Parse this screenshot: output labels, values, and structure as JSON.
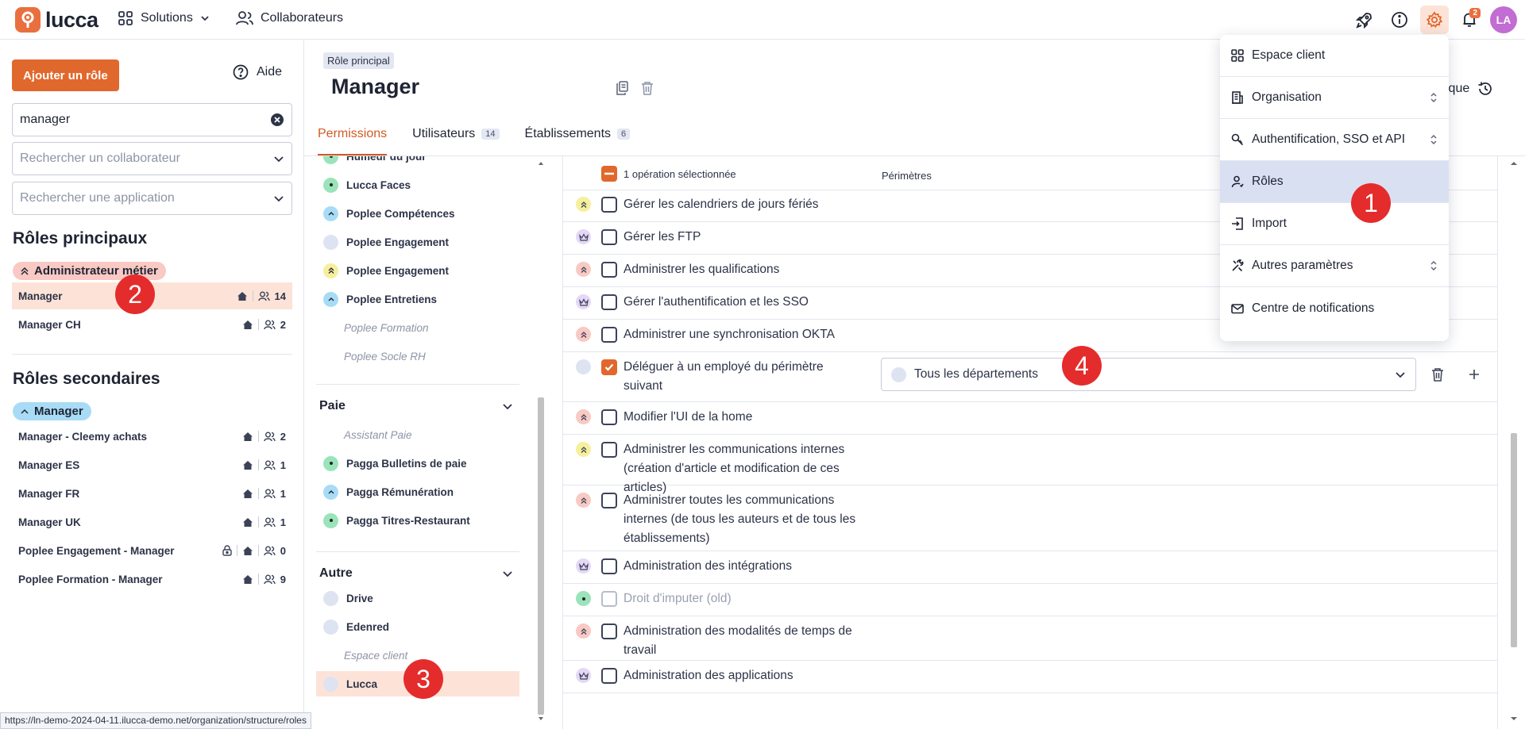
{
  "topbar": {
    "logo": "lucca",
    "nav": [
      {
        "label": "Solutions",
        "icon": "grid-icon"
      },
      {
        "label": "Collaborateurs",
        "icon": "users-icon"
      }
    ],
    "notification_count": "2",
    "avatar_initials": "LA"
  },
  "left": {
    "add_button": "Ajouter un rôle",
    "help": "Aide",
    "search_value": "manager",
    "collab_placeholder": "Rechercher un collaborateur",
    "app_placeholder": "Rechercher une application",
    "primary_title": "Rôles principaux",
    "primary_tag": "Administrateur métier",
    "primary_roles": [
      {
        "name": "Manager",
        "count": "14"
      },
      {
        "name": "Manager CH",
        "count": "2"
      }
    ],
    "secondary_title": "Rôles secondaires",
    "secondary_tag": "Manager",
    "secondary_roles": [
      {
        "name": "Manager - Cleemy achats",
        "count": "2"
      },
      {
        "name": "Manager ES",
        "count": "1"
      },
      {
        "name": "Manager FR",
        "count": "1"
      },
      {
        "name": "Manager UK",
        "count": "1"
      },
      {
        "name": "Poplee Engagement - Manager",
        "count": "0"
      },
      {
        "name": "Poplee Formation - Manager",
        "count": "9"
      }
    ]
  },
  "header": {
    "badge": "Rôle principal",
    "title": "Manager",
    "history_fragment": "ique",
    "tabs": [
      {
        "label": "Permissions",
        "count": ""
      },
      {
        "label": "Utilisateurs",
        "count": "14"
      },
      {
        "label": "Établissements",
        "count": "6"
      }
    ]
  },
  "apps": {
    "list1": [
      {
        "name": "Humeur du jour",
        "color": "#9be3b9"
      },
      {
        "name": "Lucca Faces",
        "color": "#9be3b9"
      },
      {
        "name": "Poplee Compétences",
        "color": "#a8dbf5"
      },
      {
        "name": "Poplee Engagement",
        "color": "#dde3f1"
      },
      {
        "name": "Poplee Engagement",
        "color": "#f6ef9c"
      },
      {
        "name": "Poplee Entretiens",
        "color": "#a8dbf5"
      },
      {
        "name": "Poplee Formation",
        "color": ""
      },
      {
        "name": "Poplee Socle RH",
        "color": ""
      }
    ],
    "group_paie": "Paie",
    "list2": [
      {
        "name": "Assistant Paie",
        "color": ""
      },
      {
        "name": "Pagga Bulletins de paie",
        "color": "#9be3b9"
      },
      {
        "name": "Pagga Rémunération",
        "color": "#a8dbf5"
      },
      {
        "name": "Pagga Titres-Restaurant",
        "color": "#9be3b9"
      }
    ],
    "group_autre": "Autre",
    "list3": [
      {
        "name": "Drive",
        "color": "#dde3f1"
      },
      {
        "name": "Edenred",
        "color": "#dde3f1"
      },
      {
        "name": "Espace client",
        "color": ""
      },
      {
        "name": "Lucca",
        "color": "#dde3f1"
      }
    ]
  },
  "ops": {
    "selected_text": "1 opération sélectionnée",
    "perimeter_header": "Périmètres",
    "rows": [
      {
        "label": "Gérer les calendriers de jours fériés",
        "color": "#f6ef9c",
        "level": "up",
        "checked": false
      },
      {
        "label": "Gérer les FTP",
        "color": "#e5d8f7",
        "level": "crown",
        "checked": false
      },
      {
        "label": "Administrer les qualifications",
        "color": "#f9c9c4",
        "level": "up",
        "checked": false
      },
      {
        "label": "Gérer l'authentification et les SSO",
        "color": "#e5d8f7",
        "level": "crown",
        "checked": false
      },
      {
        "label": "Administrer une synchronisation OKTA",
        "color": "#f9c9c4",
        "level": "up",
        "checked": false
      },
      {
        "label": "Déléguer à un employé du périmètre suivant",
        "color": "#dde3f1",
        "level": "none",
        "checked": true
      },
      {
        "label": "Modifier l'UI de la home",
        "color": "#f9c9c4",
        "level": "up",
        "checked": false
      },
      {
        "label": "Administrer les communications internes (création d'article et modification de ces articles)",
        "color": "#f6ef9c",
        "level": "up",
        "checked": false
      },
      {
        "label": "Administrer toutes les communications internes (de tous les auteurs et de tous les établissements)",
        "color": "#f9c9c4",
        "level": "up",
        "checked": false
      },
      {
        "label": "Administration des intégrations",
        "color": "#e5d8f7",
        "level": "crown",
        "checked": false
      },
      {
        "label": "Droit d'imputer (old)",
        "color": "#9be3b9",
        "level": "dot",
        "checked": false
      },
      {
        "label": "Administration des modalités de temps de travail",
        "color": "#f9c9c4",
        "level": "up",
        "checked": false
      },
      {
        "label": "Administration des applications",
        "color": "#e5d8f7",
        "level": "crown",
        "checked": false
      }
    ],
    "perimeter_value": "Tous les départements"
  },
  "menu": {
    "items": [
      {
        "label": "Espace client",
        "icon": "grid-icon"
      },
      {
        "label": "Organisation",
        "icon": "building-icon"
      },
      {
        "label": "Authentification, SSO et API",
        "icon": "key-icon"
      },
      {
        "label": "Rôles",
        "icon": "user-role-icon"
      },
      {
        "label": "Import",
        "icon": "import-icon"
      },
      {
        "label": "Autres paramètres",
        "icon": "tools-icon"
      },
      {
        "label": "Centre de notifications",
        "icon": "mail-icon"
      }
    ]
  },
  "markers": [
    "1",
    "2",
    "3",
    "4"
  ],
  "status_url": "https://ln-demo-2024-04-11.ilucca-demo.net/organization/structure/roles",
  "colors": {
    "accent": "#e1682c",
    "selected_bg": "#fde3d7",
    "menu_active": "#d9e0f2",
    "marker": "#e42c2c"
  }
}
